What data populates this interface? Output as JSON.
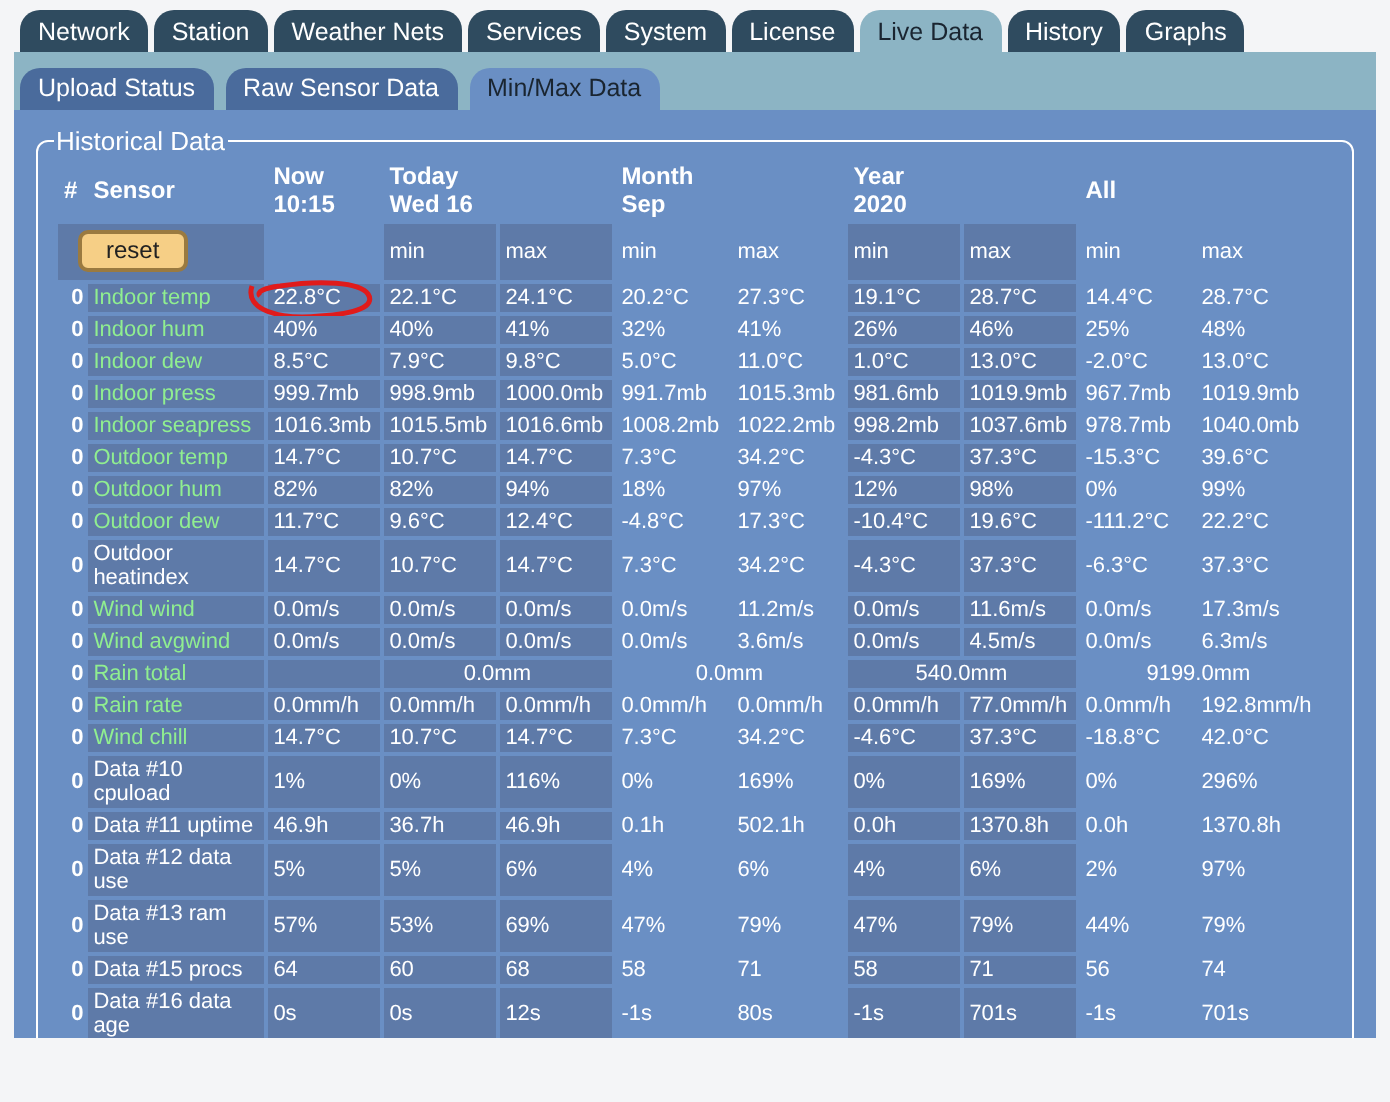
{
  "top_tabs": [
    {
      "label": "Network",
      "selected": false
    },
    {
      "label": "Station",
      "selected": false
    },
    {
      "label": "Weather Nets",
      "selected": false
    },
    {
      "label": "Services",
      "selected": false
    },
    {
      "label": "System",
      "selected": false
    },
    {
      "label": "License",
      "selected": false
    },
    {
      "label": "Live Data",
      "selected": true
    },
    {
      "label": "History",
      "selected": false
    },
    {
      "label": "Graphs",
      "selected": false
    }
  ],
  "sub_tabs": [
    {
      "label": "Upload Status",
      "selected": false
    },
    {
      "label": "Raw Sensor Data",
      "selected": false
    },
    {
      "label": "Min/Max Data",
      "selected": true
    }
  ],
  "panel": {
    "legend": "Historical Data",
    "hash_header": "#",
    "sensor_header": "Sensor",
    "periods": [
      {
        "title": "Now",
        "subtitle": "10:15"
      },
      {
        "title": "Today",
        "subtitle": "Wed 16"
      },
      {
        "title": "Month",
        "subtitle": "Sep"
      },
      {
        "title": "Year",
        "subtitle": "2020"
      },
      {
        "title": "All"
      }
    ],
    "reset_button": "reset",
    "subheaders": [
      "min",
      "max",
      "min",
      "max",
      "min",
      "max",
      "min",
      "max"
    ],
    "rows": [
      {
        "index": "0",
        "sensor": "Indoor temp",
        "color": "#90ee90",
        "kind": "minmax",
        "circled": true,
        "values": [
          "22.8°C",
          "22.1°C",
          "24.1°C",
          "20.2°C",
          "27.3°C",
          "19.1°C",
          "28.7°C",
          "14.4°C",
          "28.7°C"
        ]
      },
      {
        "index": "0",
        "sensor": "Indoor hum",
        "color": "#90ee90",
        "kind": "minmax",
        "circled": false,
        "values": [
          "40%",
          "40%",
          "41%",
          "32%",
          "41%",
          "26%",
          "46%",
          "25%",
          "48%"
        ]
      },
      {
        "index": "0",
        "sensor": "Indoor dew",
        "color": "#90ee90",
        "kind": "minmax",
        "circled": false,
        "values": [
          "8.5°C",
          "7.9°C",
          "9.8°C",
          "5.0°C",
          "11.0°C",
          "1.0°C",
          "13.0°C",
          "-2.0°C",
          "13.0°C"
        ]
      },
      {
        "index": "0",
        "sensor": "Indoor press",
        "color": "#90ee90",
        "kind": "minmax",
        "circled": false,
        "values": [
          "999.7mb",
          "998.9mb",
          "1000.0mb",
          "991.7mb",
          "1015.3mb",
          "981.6mb",
          "1019.9mb",
          "967.7mb",
          "1019.9mb"
        ]
      },
      {
        "index": "0",
        "sensor": "Indoor seapress",
        "color": "#90ee90",
        "kind": "minmax",
        "circled": false,
        "values": [
          "1016.3mb",
          "1015.5mb",
          "1016.6mb",
          "1008.2mb",
          "1022.2mb",
          "998.2mb",
          "1037.6mb",
          "978.7mb",
          "1040.0mb"
        ]
      },
      {
        "index": "0",
        "sensor": "Outdoor temp",
        "color": "#90ee90",
        "kind": "minmax",
        "circled": false,
        "values": [
          "14.7°C",
          "10.7°C",
          "14.7°C",
          "7.3°C",
          "34.2°C",
          "-4.3°C",
          "37.3°C",
          "-15.3°C",
          "39.6°C"
        ]
      },
      {
        "index": "0",
        "sensor": "Outdoor hum",
        "color": "#90ee90",
        "kind": "minmax",
        "circled": false,
        "values": [
          "82%",
          "82%",
          "94%",
          "18%",
          "97%",
          "12%",
          "98%",
          "0%",
          "99%"
        ]
      },
      {
        "index": "0",
        "sensor": "Outdoor dew",
        "color": "#90ee90",
        "kind": "minmax",
        "circled": false,
        "values": [
          "11.7°C",
          "9.6°C",
          "12.4°C",
          "-4.8°C",
          "17.3°C",
          "-10.4°C",
          "19.6°C",
          "-111.2°C",
          "22.2°C"
        ]
      },
      {
        "index": "0",
        "sensor": "Outdoor heatindex",
        "color": "#ffffff",
        "kind": "minmax",
        "circled": false,
        "values": [
          "14.7°C",
          "10.7°C",
          "14.7°C",
          "7.3°C",
          "34.2°C",
          "-4.3°C",
          "37.3°C",
          "-6.3°C",
          "37.3°C"
        ]
      },
      {
        "index": "0",
        "sensor": "Wind wind",
        "color": "#90ee90",
        "kind": "minmax",
        "circled": false,
        "values": [
          "0.0m/s",
          "0.0m/s",
          "0.0m/s",
          "0.0m/s",
          "11.2m/s",
          "0.0m/s",
          "11.6m/s",
          "0.0m/s",
          "17.3m/s"
        ]
      },
      {
        "index": "0",
        "sensor": "Wind avgwind",
        "color": "#90ee90",
        "kind": "minmax",
        "circled": false,
        "values": [
          "0.0m/s",
          "0.0m/s",
          "0.0m/s",
          "0.0m/s",
          "3.6m/s",
          "0.0m/s",
          "4.5m/s",
          "0.0m/s",
          "6.3m/s"
        ]
      },
      {
        "index": "0",
        "sensor": "Rain total",
        "color": "#90ee90",
        "kind": "total",
        "circled": false,
        "values": [
          "0.0mm",
          "0.0mm",
          "540.0mm",
          "9199.0mm"
        ]
      },
      {
        "index": "0",
        "sensor": "Rain rate",
        "color": "#90ee90",
        "kind": "minmax",
        "circled": false,
        "values": [
          "0.0mm/h",
          "0.0mm/h",
          "0.0mm/h",
          "0.0mm/h",
          "0.0mm/h",
          "0.0mm/h",
          "77.0mm/h",
          "0.0mm/h",
          "192.8mm/h"
        ]
      },
      {
        "index": "0",
        "sensor": "Wind chill",
        "color": "#90ee90",
        "kind": "minmax",
        "circled": false,
        "values": [
          "14.7°C",
          "10.7°C",
          "14.7°C",
          "7.3°C",
          "34.2°C",
          "-4.6°C",
          "37.3°C",
          "-18.8°C",
          "42.0°C"
        ]
      },
      {
        "index": "0",
        "sensor": "Data #10 cpuload",
        "color": "#ffffff",
        "kind": "minmax",
        "circled": false,
        "values": [
          "1%",
          "0%",
          "116%",
          "0%",
          "169%",
          "0%",
          "169%",
          "0%",
          "296%"
        ]
      },
      {
        "index": "0",
        "sensor": "Data #11 uptime",
        "color": "#ffffff",
        "kind": "minmax",
        "circled": false,
        "values": [
          "46.9h",
          "36.7h",
          "46.9h",
          "0.1h",
          "502.1h",
          "0.0h",
          "1370.8h",
          "0.0h",
          "1370.8h"
        ]
      },
      {
        "index": "0",
        "sensor": "Data #12 data use",
        "color": "#ffffff",
        "kind": "minmax",
        "circled": false,
        "values": [
          "5%",
          "5%",
          "6%",
          "4%",
          "6%",
          "4%",
          "6%",
          "2%",
          "97%"
        ]
      },
      {
        "index": "0",
        "sensor": "Data #13 ram use",
        "color": "#ffffff",
        "kind": "minmax",
        "circled": false,
        "values": [
          "57%",
          "53%",
          "69%",
          "47%",
          "79%",
          "47%",
          "79%",
          "44%",
          "79%"
        ]
      },
      {
        "index": "0",
        "sensor": "Data #15 procs",
        "color": "#ffffff",
        "kind": "minmax",
        "circled": false,
        "values": [
          "64",
          "60",
          "68",
          "58",
          "71",
          "58",
          "71",
          "56",
          "74"
        ]
      },
      {
        "index": "0",
        "sensor": "Data #16 data age",
        "color": "#ffffff",
        "kind": "minmax",
        "circled": false,
        "values": [
          "0s",
          "0s",
          "12s",
          "-1s",
          "80s",
          "-1s",
          "701s",
          "-1s",
          "701s"
        ]
      }
    ]
  }
}
